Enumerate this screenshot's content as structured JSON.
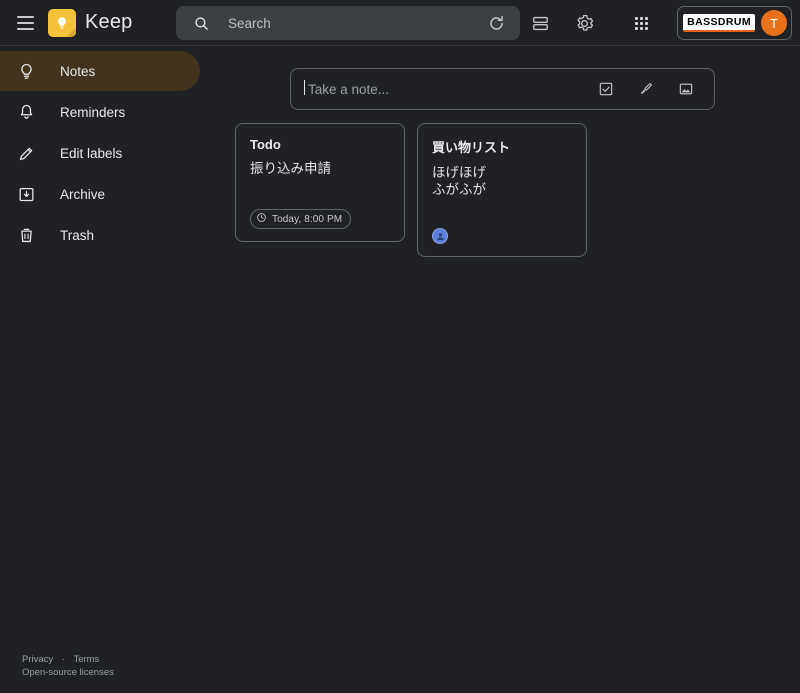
{
  "header": {
    "menu_icon": "hamburger-icon",
    "logo_icon": "keep-lightbulb-logo",
    "app_title": "Keep",
    "search": {
      "icon": "search-icon",
      "placeholder": "Search",
      "value": ""
    },
    "actions": [
      {
        "name": "refresh",
        "icon": "refresh-icon"
      },
      {
        "name": "list-view",
        "icon": "list-view-icon"
      },
      {
        "name": "settings",
        "icon": "gear-icon"
      },
      {
        "name": "google-apps",
        "icon": "apps-grid-icon"
      }
    ],
    "account": {
      "brand_label": "BASSDRUM",
      "brand_underline_color": "#e8611a",
      "avatar_initial": "T",
      "avatar_color": "#e8721c"
    }
  },
  "sidebar": {
    "items": [
      {
        "label": "Notes",
        "icon": "lightbulb-icon",
        "active": true
      },
      {
        "label": "Reminders",
        "icon": "bell-icon",
        "active": false
      },
      {
        "label": "Edit labels",
        "icon": "pencil-icon",
        "active": false
      },
      {
        "label": "Archive",
        "icon": "archive-icon",
        "active": false
      },
      {
        "label": "Trash",
        "icon": "trash-icon",
        "active": false
      }
    ],
    "active_color": "#41331c"
  },
  "composer": {
    "placeholder": "Take a note...",
    "icons": [
      {
        "name": "new-list",
        "icon": "checkbox-icon"
      },
      {
        "name": "new-drawing",
        "icon": "brush-icon"
      },
      {
        "name": "new-image-note",
        "icon": "image-icon"
      }
    ]
  },
  "notes": [
    {
      "title": "Todo",
      "body": "振り込み申請",
      "reminder": {
        "icon": "clock-icon",
        "label": "Today, 8:00 PM"
      },
      "collaborator": null
    },
    {
      "title": "買い物リスト",
      "body": "ほげほげ\nふがふが",
      "reminder": null,
      "collaborator": {
        "icon": "person-avatar",
        "color": "#5b7fdb"
      }
    }
  ],
  "footer": {
    "privacy": "Privacy",
    "separator": "·",
    "terms": "Terms",
    "licenses": "Open-source licenses"
  },
  "theme": {
    "background": "#202124",
    "surface": "#202124",
    "border": "#5f6368",
    "text_primary": "#e8eaed",
    "text_secondary": "#9aa0a6"
  }
}
